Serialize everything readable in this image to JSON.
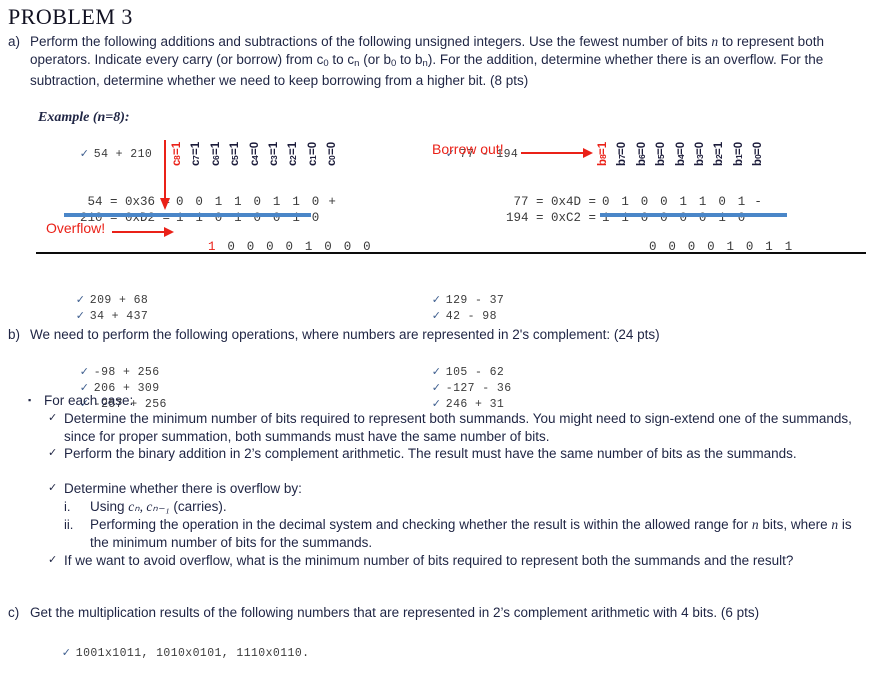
{
  "document": {
    "title": "PROBLEM 3"
  },
  "colors": {
    "red": "#ea2118",
    "blue_bar": "#4a86c8",
    "text": "#1f2544",
    "mono_text": "#3a3a3a",
    "check": "#3f5f8f"
  },
  "part_a": {
    "marker": "a)",
    "text_1": "Perform the following additions and subtractions of the following unsigned integers. Use the fewest number of bits ",
    "var_n": "n",
    "text_2": " to represent both operators. Indicate every carry (or borrow) from c",
    "sub_0": "0",
    "text_3": " to c",
    "sub_n": "n",
    "text_4": " (or b",
    "sub_0b": "0",
    "text_5": " to b",
    "sub_nb": "n",
    "text_6": "). For the addition, determine whether there is an overflow.  For the subtraction, determine whether we need to keep borrowing from a higher bit. (8 pts)",
    "example_label": "Example (n=8):",
    "addition_example": {
      "check": "✓",
      "heading": "54 + 210",
      "carry_labels": [
        {
          "name": "c",
          "sub": "8",
          "value": "1",
          "red": true
        },
        {
          "name": "c",
          "sub": "7",
          "value": "1",
          "red": false
        },
        {
          "name": "c",
          "sub": "6",
          "value": "1",
          "red": false
        },
        {
          "name": "c",
          "sub": "5",
          "value": "1",
          "red": false
        },
        {
          "name": "c",
          "sub": "4",
          "value": "0",
          "red": false
        },
        {
          "name": "c",
          "sub": "3",
          "value": "1",
          "red": false
        },
        {
          "name": "c",
          "sub": "2",
          "value": "1",
          "red": false
        },
        {
          "name": "c",
          "sub": "1",
          "value": "0",
          "red": false
        },
        {
          "name": "c",
          "sub": "0",
          "value": "0",
          "red": false
        }
      ],
      "operand1_label": " 54 = 0x36 =",
      "operand1_bits": [
        "0",
        "0",
        "1",
        "1",
        "0",
        "1",
        "1",
        "0"
      ],
      "operand1_sign": "+",
      "operand2_label": "210 = 0xD2 =",
      "operand2_bits": [
        "1",
        "1",
        "0",
        "1",
        "0",
        "0",
        "1",
        "0"
      ],
      "operand2_sign": "",
      "result_bits": [
        "1",
        "0",
        "0",
        "0",
        "0",
        "1",
        "0",
        "0",
        "0"
      ],
      "result_red_index": 0,
      "annotation": "Overflow!"
    },
    "subtraction_example": {
      "check": "✓",
      "heading": "77 - 194",
      "borrow_labels": [
        {
          "name": "b",
          "sub": "8",
          "value": "1",
          "red": true
        },
        {
          "name": "b",
          "sub": "7",
          "value": "0",
          "red": false
        },
        {
          "name": "b",
          "sub": "6",
          "value": "0",
          "red": false
        },
        {
          "name": "b",
          "sub": "5",
          "value": "0",
          "red": false
        },
        {
          "name": "b",
          "sub": "4",
          "value": "0",
          "red": false
        },
        {
          "name": "b",
          "sub": "3",
          "value": "0",
          "red": false
        },
        {
          "name": "b",
          "sub": "2",
          "value": "1",
          "red": false
        },
        {
          "name": "b",
          "sub": "1",
          "value": "0",
          "red": false
        },
        {
          "name": "b",
          "sub": "0",
          "value": "0",
          "red": false
        }
      ],
      "operand1_label": " 77 = 0x4D =",
      "operand1_bits": [
        "0",
        "1",
        "0",
        "0",
        "1",
        "1",
        "0",
        "1"
      ],
      "operand1_sign": "-",
      "operand2_label": "194 = 0xC2 =",
      "operand2_bits": [
        "1",
        "1",
        "0",
        "0",
        "0",
        "0",
        "1",
        "0"
      ],
      "operand2_sign": "",
      "result_bits": [
        "0",
        "0",
        "0",
        "0",
        "1",
        "0",
        "1",
        "1"
      ],
      "annotation": "Borrow out!"
    },
    "practice_left": [
      "209 + 68",
      "34 + 437"
    ],
    "practice_right": [
      "129 - 37",
      "42 - 98"
    ]
  },
  "part_b": {
    "marker": "b)",
    "text": "We need to perform the following operations, where numbers are represented in 2's complement: (24 pts)",
    "cases_left": [
      "-98 + 256",
      "206 + 309",
      "-257 + 256"
    ],
    "cases_right": [
      "105 - 62",
      "-127 - 36",
      "246 + 31"
    ],
    "for_each_case_bullet": "▪",
    "for_each_case": "For each case:",
    "check_items": [
      "Determine the minimum number of bits required to represent both summands. You might need to sign-extend one of the summands, since for proper summation, both summands must have the same number of bits.",
      "Perform the binary addition in 2’s complement arithmetic. The result must have the same number of bits as the summands.",
      "Determine whether there is overflow by:"
    ],
    "roman_items": [
      {
        "marker": "i.",
        "pre": "Using ",
        "math": "cₙ, cₙ₋₁",
        "post": " (carries)."
      },
      {
        "marker": "ii.",
        "pre": "Performing the operation in the decimal system and checking whether the result is within the allowed range for ",
        "math": "n",
        "post": " bits, where ",
        "math2": "n",
        "post2": " is the minimum number of bits for the summands."
      }
    ],
    "final_check": "If we want to avoid overflow, what is the minimum number of bits required to represent both the summands and the result?"
  },
  "part_c": {
    "marker": "c)",
    "text": "Get the multiplication results of the following numbers that are represented in 2’s complement arithmetic with 4 bits. (6 pts)",
    "items": "1001x1011, 1010x0101, 1110x0110."
  },
  "glyphs": {
    "check": "✓",
    "square_bullet": "▪"
  }
}
